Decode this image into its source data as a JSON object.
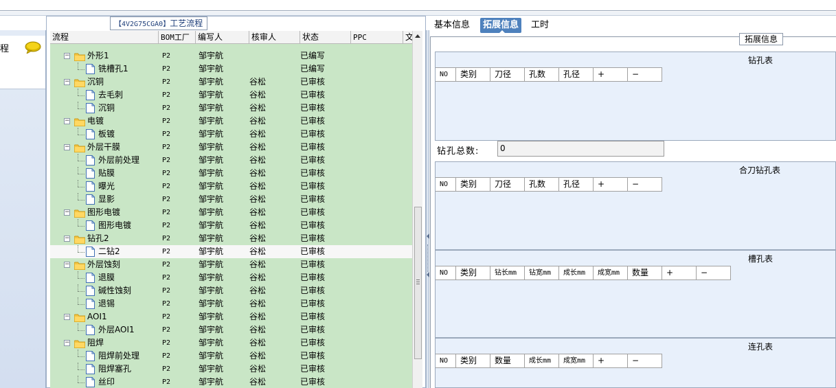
{
  "left_nav": {
    "item_label": "程"
  },
  "process_panel": {
    "title_code": "【4V2G75CGA0】",
    "title_text": "工艺流程",
    "columns": [
      "流程",
      "BOM工厂",
      "编写人",
      "核审人",
      "状态",
      "PPC",
      "文"
    ],
    "rows": [
      {
        "name": "外形1",
        "type": "folder",
        "level": 0,
        "bom": "P2",
        "author": "邹宇航",
        "reviewer": "",
        "status": "已编写"
      },
      {
        "name": "铣槽孔1",
        "type": "doc",
        "level": 1,
        "bom": "P2",
        "author": "邹宇航",
        "reviewer": "",
        "status": "已编写"
      },
      {
        "name": "沉铜",
        "type": "folder",
        "level": 0,
        "bom": "P2",
        "author": "邹宇航",
        "reviewer": "谷松",
        "status": "已审核"
      },
      {
        "name": "去毛刺",
        "type": "doc",
        "level": 1,
        "bom": "P2",
        "author": "邹宇航",
        "reviewer": "谷松",
        "status": "已审核"
      },
      {
        "name": "沉铜",
        "type": "doc",
        "level": 1,
        "bom": "P2",
        "author": "邹宇航",
        "reviewer": "谷松",
        "status": "已审核"
      },
      {
        "name": "电镀",
        "type": "folder",
        "level": 0,
        "bom": "P2",
        "author": "邹宇航",
        "reviewer": "谷松",
        "status": "已审核"
      },
      {
        "name": "板镀",
        "type": "doc",
        "level": 1,
        "bom": "P2",
        "author": "邹宇航",
        "reviewer": "谷松",
        "status": "已审核"
      },
      {
        "name": "外层干膜",
        "type": "folder",
        "level": 0,
        "bom": "P2",
        "author": "邹宇航",
        "reviewer": "谷松",
        "status": "已审核"
      },
      {
        "name": "外层前处理",
        "type": "doc",
        "level": 1,
        "bom": "P2",
        "author": "邹宇航",
        "reviewer": "谷松",
        "status": "已审核"
      },
      {
        "name": "贴膜",
        "type": "doc",
        "level": 1,
        "bom": "P2",
        "author": "邹宇航",
        "reviewer": "谷松",
        "status": "已审核"
      },
      {
        "name": "曝光",
        "type": "doc",
        "level": 1,
        "bom": "P2",
        "author": "邹宇航",
        "reviewer": "谷松",
        "status": "已审核"
      },
      {
        "name": "显影",
        "type": "doc",
        "level": 1,
        "bom": "P2",
        "author": "邹宇航",
        "reviewer": "谷松",
        "status": "已审核"
      },
      {
        "name": "图形电镀",
        "type": "folder",
        "level": 0,
        "bom": "P2",
        "author": "邹宇航",
        "reviewer": "谷松",
        "status": "已审核"
      },
      {
        "name": "图形电镀",
        "type": "doc",
        "level": 1,
        "bom": "P2",
        "author": "邹宇航",
        "reviewer": "谷松",
        "status": "已审核"
      },
      {
        "name": "钻孔2",
        "type": "folder",
        "level": 0,
        "bom": "P2",
        "author": "邹宇航",
        "reviewer": "谷松",
        "status": "已审核"
      },
      {
        "name": "二钻2",
        "type": "doc",
        "level": 1,
        "bom": "P2",
        "author": "邹宇航",
        "reviewer": "谷松",
        "status": "已审核",
        "selected": true
      },
      {
        "name": "外层蚀刻",
        "type": "folder",
        "level": 0,
        "bom": "P2",
        "author": "邹宇航",
        "reviewer": "谷松",
        "status": "已审核"
      },
      {
        "name": "退膜",
        "type": "doc",
        "level": 1,
        "bom": "P2",
        "author": "邹宇航",
        "reviewer": "谷松",
        "status": "已审核"
      },
      {
        "name": "碱性蚀刻",
        "type": "doc",
        "level": 1,
        "bom": "P2",
        "author": "邹宇航",
        "reviewer": "谷松",
        "status": "已审核"
      },
      {
        "name": "退锡",
        "type": "doc",
        "level": 1,
        "bom": "P2",
        "author": "邹宇航",
        "reviewer": "谷松",
        "status": "已审核"
      },
      {
        "name": "AOI1",
        "type": "folder",
        "level": 0,
        "bom": "P2",
        "author": "邹宇航",
        "reviewer": "谷松",
        "status": "已审核"
      },
      {
        "name": "外层AOI1",
        "type": "doc",
        "level": 1,
        "bom": "P2",
        "author": "邹宇航",
        "reviewer": "谷松",
        "status": "已审核"
      },
      {
        "name": "阻焊",
        "type": "folder",
        "level": 0,
        "bom": "P2",
        "author": "邹宇航",
        "reviewer": "谷松",
        "status": "已审核"
      },
      {
        "name": "阻焊前处理",
        "type": "doc",
        "level": 1,
        "bom": "P2",
        "author": "邹宇航",
        "reviewer": "谷松",
        "status": "已审核"
      },
      {
        "name": "阻焊塞孔",
        "type": "doc",
        "level": 1,
        "bom": "P2",
        "author": "邹宇航",
        "reviewer": "谷松",
        "status": "已审核"
      },
      {
        "name": "丝印",
        "type": "doc",
        "level": 1,
        "bom": "P2",
        "author": "邹宇航",
        "reviewer": "谷松",
        "status": "已审核"
      }
    ]
  },
  "right_panel": {
    "tabs": [
      {
        "label": "基本信息",
        "active": false
      },
      {
        "label": "拓展信息",
        "active": true
      },
      {
        "label": "工时",
        "active": false
      }
    ],
    "group_title": "拓展信息",
    "drill_table": {
      "title": "钻孔表",
      "columns": [
        "NO",
        "类别",
        "刀径",
        "孔数",
        "孔径",
        "+",
        "−"
      ]
    },
    "drill_total": {
      "label": "钻孔总数:",
      "value": "0"
    },
    "combined_drill_table": {
      "title": "合刀钻孔表",
      "columns": [
        "NO",
        "类别",
        "刀径",
        "孔数",
        "孔径",
        "+",
        "−"
      ]
    },
    "slot_table": {
      "title": "槽孔表",
      "columns": [
        "NO",
        "类别",
        "钻长mm",
        "钻宽mm",
        "成长mm",
        "成宽mm",
        "数量",
        "+",
        "−"
      ]
    },
    "link_table": {
      "title": "连孔表",
      "columns": [
        "NO",
        "类别",
        "数量",
        "成长mm",
        "成宽mm",
        "+",
        "−"
      ]
    }
  },
  "colors": {
    "grid_bg": "#c9e6c6",
    "active_tab": "#4e81bd",
    "table_bg": "#e8f0fb",
    "folder": "#f4c542"
  }
}
